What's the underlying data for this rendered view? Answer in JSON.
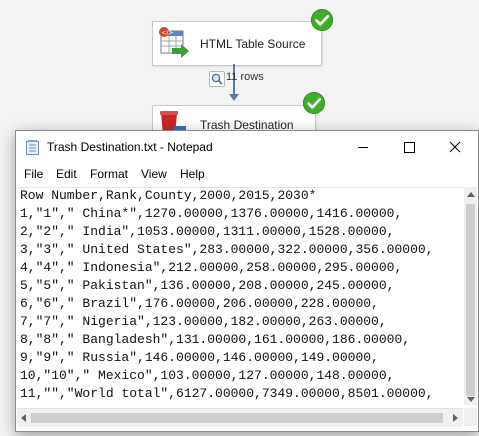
{
  "canvas": {
    "source_label": "HTML Table Source",
    "rows_label": "11 rows",
    "dest_label": "Trash Destination"
  },
  "icons": {
    "status_ok": "green-check-icon",
    "source": "html-table-source-icon",
    "destination": "trash-destination-icon",
    "data_viewer": "data-viewer-icon",
    "notepad": "notepad-icon"
  },
  "colors": {
    "status_ok": "#3fae2c",
    "connector": "#5b79a6"
  },
  "notepad": {
    "title": "Trash Destination.txt - Notepad",
    "menu": [
      "File",
      "Edit",
      "Format",
      "View",
      "Help"
    ],
    "lines": [
      "Row Number,Rank,County,2000,2015,2030*",
      "1,\"1\",\" China*\",1270.00000,1376.00000,1416.00000,",
      "2,\"2\",\" India\",1053.00000,1311.00000,1528.00000,",
      "3,\"3\",\" United States\",283.00000,322.00000,356.00000,",
      "4,\"4\",\" Indonesia\",212.00000,258.00000,295.00000,",
      "5,\"5\",\" Pakistan\",136.00000,208.00000,245.00000,",
      "6,\"6\",\" Brazil\",176.00000,206.00000,228.00000,",
      "7,\"7\",\" Nigeria\",123.00000,182.00000,263.00000,",
      "8,\"8\",\" Bangladesh\",131.00000,161.00000,186.00000,",
      "9,\"9\",\" Russia\",146.00000,146.00000,149.00000,",
      "10,\"10\",\" Mexico\",103.00000,127.00000,148.00000,",
      "11,\"\",\"World total\",6127.00000,7349.00000,8501.00000,"
    ]
  }
}
